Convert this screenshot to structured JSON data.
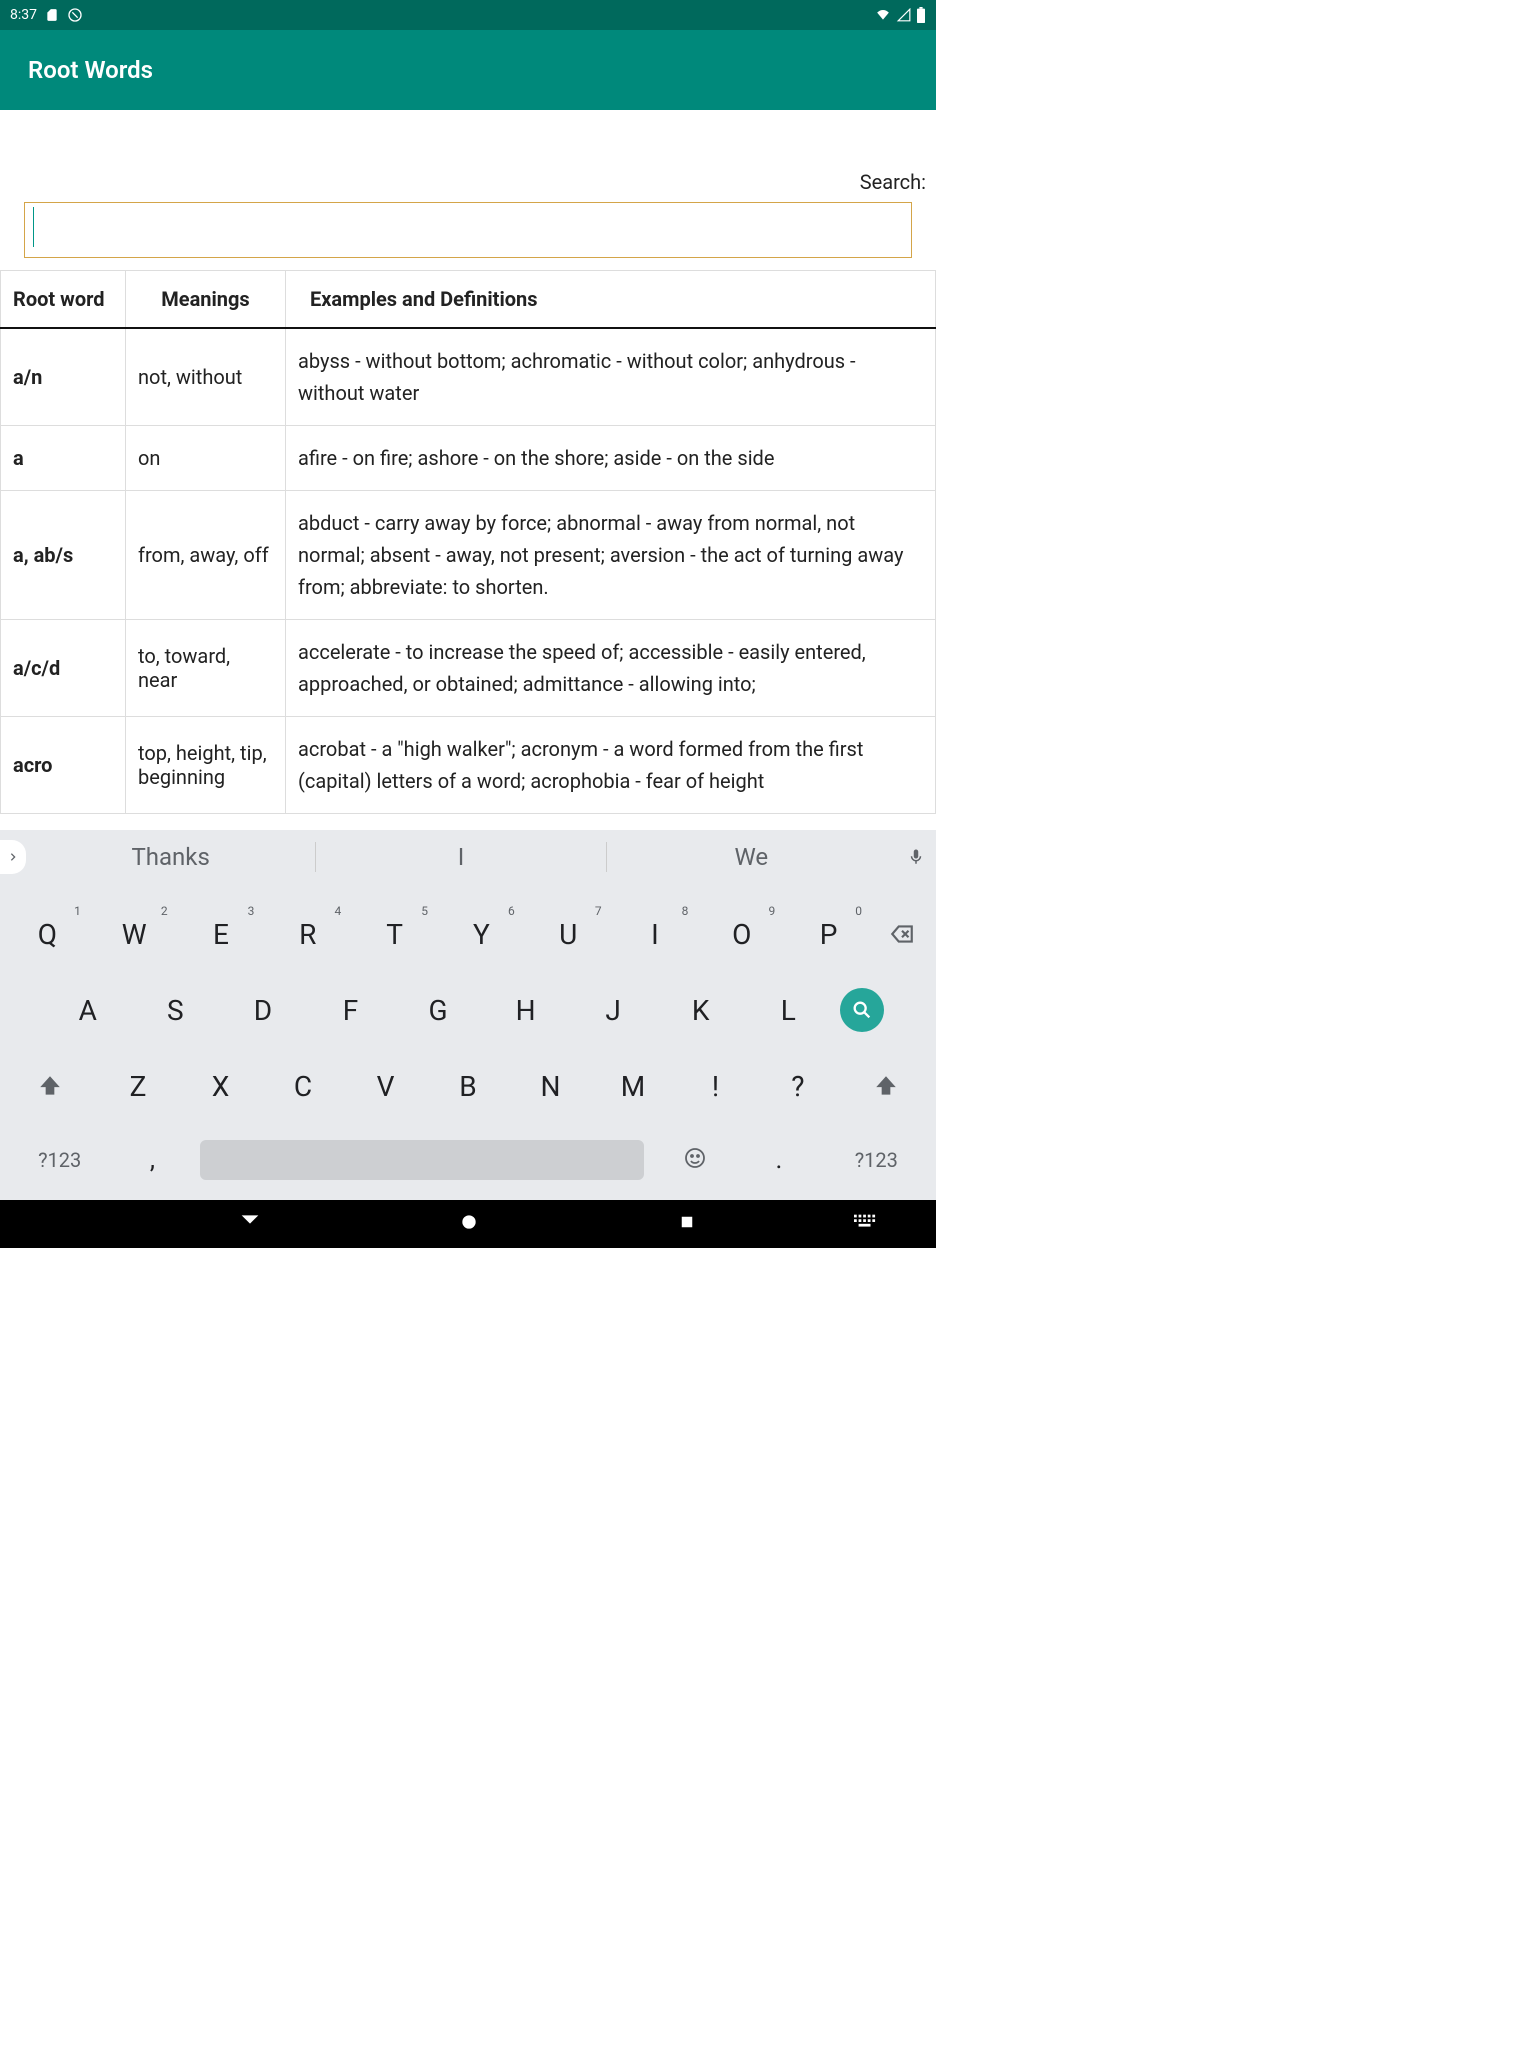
{
  "status": {
    "time": "8:37"
  },
  "app": {
    "title": "Root Words"
  },
  "search": {
    "label": "Search:",
    "value": ""
  },
  "table": {
    "headers": [
      "Root word",
      "Meanings",
      "Examples and Definitions"
    ],
    "rows": [
      {
        "root": "a/n",
        "meaning": "not, without",
        "examples": "abyss - without bottom; achromatic - without color; anhydrous - without water"
      },
      {
        "root": "a",
        "meaning": "on",
        "examples": "afire - on fire; ashore - on the shore; aside - on the side"
      },
      {
        "root": "a, ab/s",
        "meaning": "from, away, off",
        "examples": "abduct - carry away by force; abnormal - away from normal, not normal; absent - away, not present; aversion - the act of turning away from; abbreviate: to shorten."
      },
      {
        "root": "a/c/d",
        "meaning": "to, toward, near",
        "examples": "accelerate - to increase the speed of; accessible - easily entered, approached, or obtained; admittance - allowing into;"
      },
      {
        "root": "acro",
        "meaning": "top, height, tip, beginning",
        "examples": "acrobat - a \"high walker\"; acronym - a word formed from the first (capital) letters of a word; acrophobia - fear of height"
      }
    ]
  },
  "keyboard": {
    "suggestions": [
      "Thanks",
      "I",
      "We"
    ],
    "row1": [
      {
        "k": "Q",
        "h": "1"
      },
      {
        "k": "W",
        "h": "2"
      },
      {
        "k": "E",
        "h": "3"
      },
      {
        "k": "R",
        "h": "4"
      },
      {
        "k": "T",
        "h": "5"
      },
      {
        "k": "Y",
        "h": "6"
      },
      {
        "k": "U",
        "h": "7"
      },
      {
        "k": "I",
        "h": "8"
      },
      {
        "k": "O",
        "h": "9"
      },
      {
        "k": "P",
        "h": "0"
      }
    ],
    "row2": [
      "A",
      "S",
      "D",
      "F",
      "G",
      "H",
      "J",
      "K",
      "L"
    ],
    "row3": [
      "Z",
      "X",
      "C",
      "V",
      "B",
      "N",
      "M",
      "!",
      "?"
    ],
    "sym": "?123",
    "comma": ",",
    "dot": "."
  }
}
